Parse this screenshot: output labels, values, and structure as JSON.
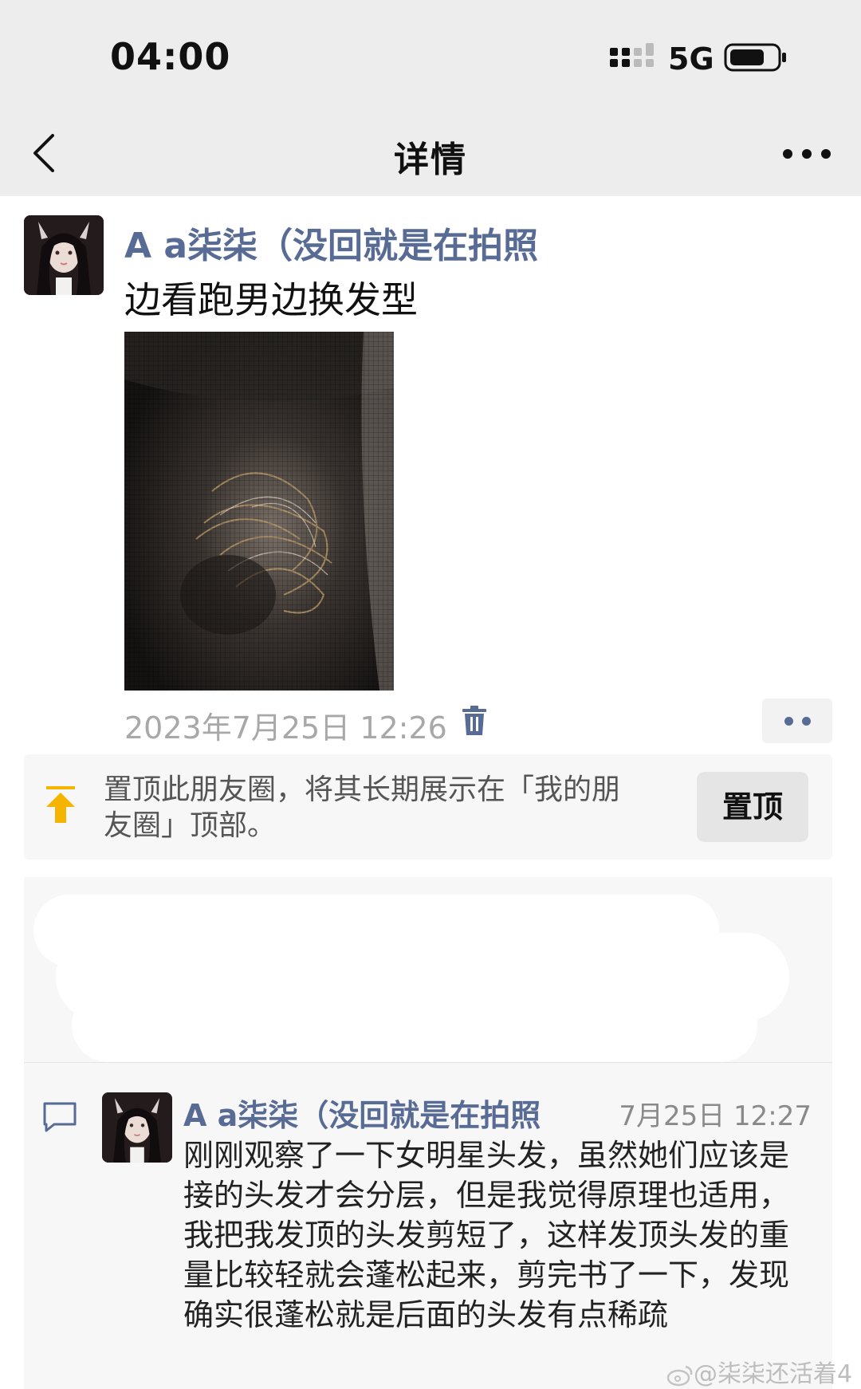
{
  "status_bar": {
    "time": "04:00",
    "network": "5G",
    "signal_icon": "signal-icon",
    "battery_icon": "battery-icon"
  },
  "nav": {
    "title": "详情",
    "back_icon": "back-chevron-icon",
    "more_icon": "more-dots-icon"
  },
  "post": {
    "author": "A a柒柒（没回就是在拍照",
    "text": "边看跑男边换发型",
    "timestamp": "2023年7月25日 12:26",
    "delete_icon": "trash-icon",
    "actions_icon": "two-dots-icon"
  },
  "pin": {
    "icon": "pin-to-top-icon",
    "description": "置顶此朋友圈，将其长期展示在「我的朋友圈」顶部。",
    "button_label": "置顶"
  },
  "comment": {
    "icon": "comment-bubble-icon",
    "author": "A a柒柒（没回就是在拍照",
    "time": "7月25日 12:27",
    "text": "刚刚观察了一下女明星头发，虽然她们应该是接的头发才会分层，但是我觉得原理也适用，我把我发顶的头发剪短了，这样发顶头发的重量比较轻就会蓬松起来，剪完书了一下，发现确实很蓬松就是后面的头发有点稀疏"
  },
  "watermark": "@柒柒还活着4",
  "colors": {
    "link": "#576b95",
    "pin_accent": "#f5b400",
    "bar_bg": "#ededed"
  }
}
